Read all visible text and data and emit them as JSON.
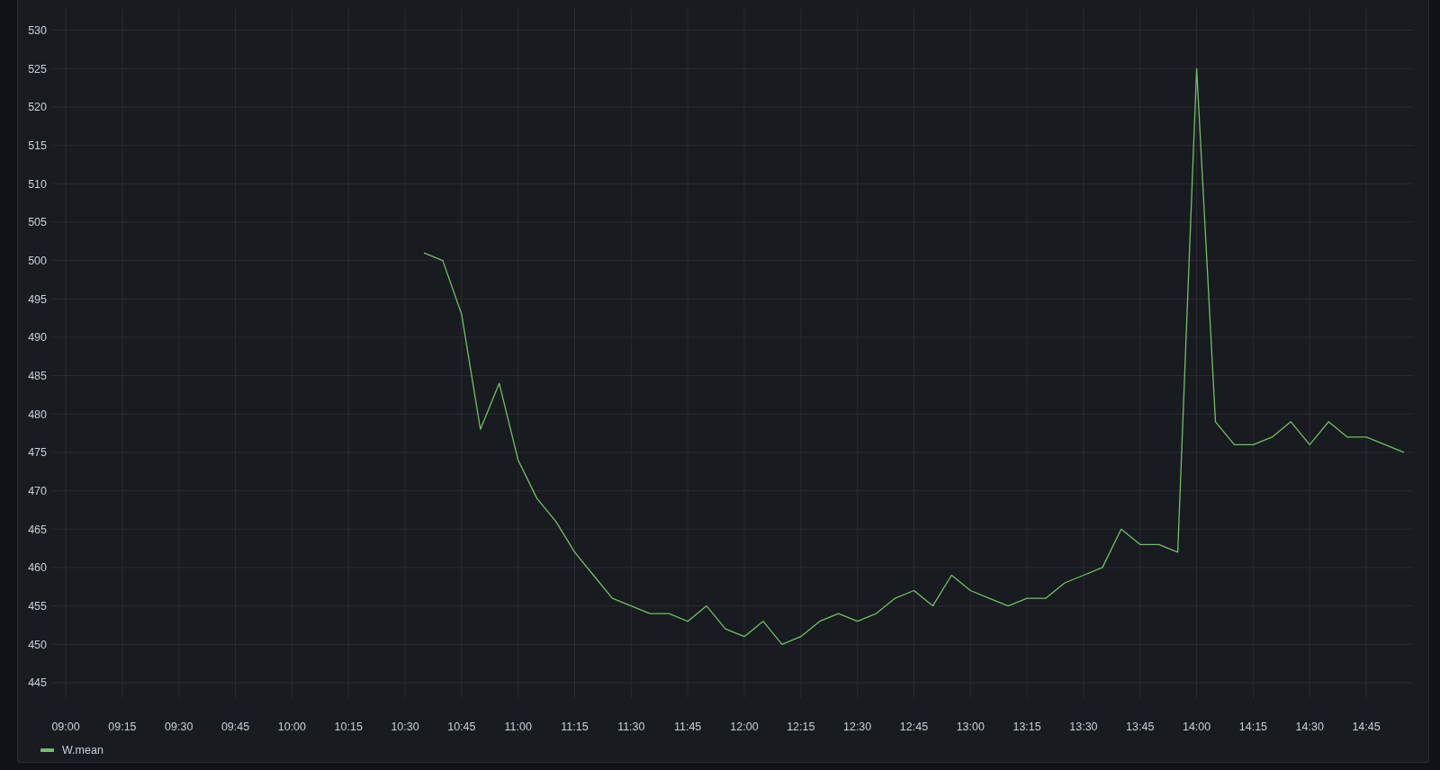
{
  "panel": {
    "chart_data": {
      "type": "line",
      "categories": [
        "09:00",
        null,
        null,
        "09:15",
        null,
        null,
        "09:30",
        null,
        null,
        "09:45",
        null,
        null,
        "10:00",
        null,
        null,
        "10:15",
        null,
        null,
        "10:30",
        null,
        null,
        "10:45",
        null,
        null,
        "11:00",
        null,
        null,
        "11:15",
        null,
        null,
        "11:30",
        null,
        null,
        "11:45",
        null,
        null,
        "12:00",
        null,
        null,
        "12:15",
        null,
        null,
        "12:30",
        null,
        null,
        "12:45",
        null,
        null,
        "13:00",
        null,
        null,
        "13:15",
        null,
        null,
        "13:30",
        null,
        null,
        "13:45",
        null,
        null,
        "14:00",
        null,
        null,
        "14:15",
        null,
        null,
        "14:30",
        null,
        null,
        "14:45",
        null,
        null
      ],
      "series": [
        {
          "name": "W.mean",
          "color": "#73bf69",
          "values": [
            null,
            null,
            null,
            null,
            null,
            null,
            null,
            null,
            null,
            null,
            null,
            null,
            null,
            null,
            null,
            null,
            null,
            null,
            null,
            501,
            500,
            493,
            478,
            484,
            474,
            469,
            466,
            462,
            459,
            456,
            455,
            454,
            454,
            453,
            455,
            452,
            451,
            453,
            450,
            451,
            453,
            454,
            453,
            454,
            456,
            457,
            455,
            459,
            457,
            456,
            455,
            456,
            456,
            458,
            459,
            460,
            465,
            463,
            463,
            462,
            525,
            479,
            476,
            476,
            477,
            479,
            476,
            479,
            477,
            477,
            476,
            475
          ]
        }
      ],
      "ylim": [
        443,
        533
      ],
      "grid": true,
      "yticks": [
        445,
        450,
        455,
        460,
        465,
        470,
        475,
        480,
        485,
        490,
        495,
        500,
        505,
        510,
        515,
        520,
        525,
        530
      ]
    }
  }
}
